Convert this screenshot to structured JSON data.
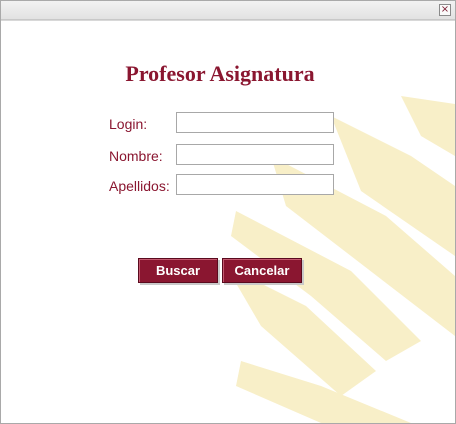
{
  "window": {
    "close_icon": "close-icon",
    "close_glyph": "×"
  },
  "form": {
    "title": "Profesor Asignatura",
    "fields": [
      {
        "label": "Login:",
        "value": "",
        "placeholder": ""
      },
      {
        "label": "Nombre:",
        "value": "",
        "placeholder": ""
      },
      {
        "label": "Apellidos:",
        "value": "",
        "placeholder": ""
      }
    ],
    "buttons": {
      "search": "Buscar",
      "cancel": "Cancelar"
    }
  },
  "colors": {
    "accent": "#8a1630",
    "watermark": "#f8efc8"
  }
}
